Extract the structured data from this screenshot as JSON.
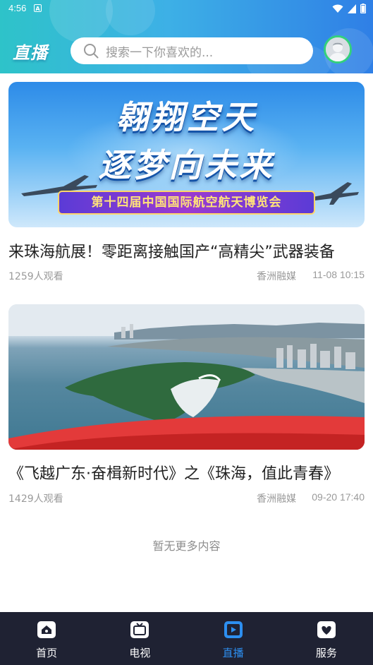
{
  "status_bar": {
    "time": "4:56",
    "notification_letter": "A"
  },
  "header": {
    "title": "直播",
    "search_placeholder": "搜索一下你喜欢的..."
  },
  "items": [
    {
      "thumbnail_line1": "翱翔空天",
      "thumbnail_line2": "逐梦向未来",
      "thumbnail_ribbon": "第十四届中国国际航空航天博览会",
      "title": "来珠海航展！零距离接触国产“高精尖”武器装备",
      "views": "1259人观看",
      "source": "香洲融媒",
      "time": "11-08 10:15"
    },
    {
      "title": "《飞越广东·奋楫新时代》之《珠海，值此青春》",
      "views": "1429人观看",
      "source": "香洲融媒",
      "time": "09-20 17:40"
    }
  ],
  "no_more_text": "暂无更多内容",
  "bottom_nav": [
    {
      "label": "首页",
      "icon": "home-icon",
      "active": false
    },
    {
      "label": "电视",
      "icon": "tv-icon",
      "active": false
    },
    {
      "label": "直播",
      "icon": "live-play-icon",
      "active": true
    },
    {
      "label": "服务",
      "icon": "heart-service-icon",
      "active": false
    }
  ],
  "colors": {
    "header_gradient_start": "#2ec3c9",
    "header_gradient_end": "#2f7fe6",
    "nav_background": "#1f2233",
    "nav_active": "#2d8ff0",
    "avatar_ring": "#34d17c"
  }
}
